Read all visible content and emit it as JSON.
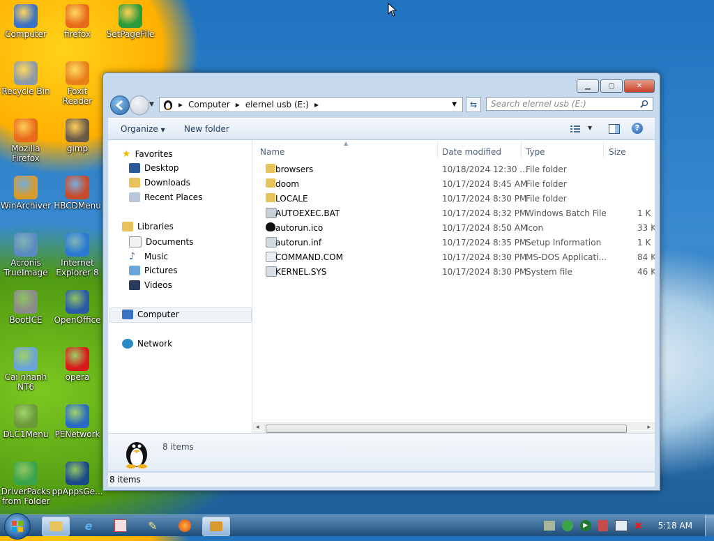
{
  "desktop": {
    "icons": [
      {
        "label": "Computer",
        "icon": "computer-icon",
        "color": "#3b73c4"
      },
      {
        "label": "firefox",
        "icon": "firefox-icon",
        "color": "#e86a1a"
      },
      {
        "label": "SetPageFile",
        "icon": "setpagefile-icon",
        "color": "#2a9a3a"
      },
      {
        "label": "Recycle Bin",
        "icon": "recycle-bin-icon",
        "color": "#8a9aa8"
      },
      {
        "label": "Foxit Reader",
        "icon": "foxit-reader-icon",
        "color": "#e8801a"
      },
      {
        "label": "Mozilla\nFirefox",
        "icon": "mozilla-firefox-icon",
        "color": "#e86a1a"
      },
      {
        "label": "gimp",
        "icon": "gimp-icon",
        "color": "#6a5a4a"
      },
      {
        "label": "WinArchiver",
        "icon": "winarchiver-icon",
        "color": "#d89a2a"
      },
      {
        "label": "HBCDMenu",
        "icon": "hbcdmenu-icon",
        "color": "#c84a2a"
      },
      {
        "label": "Acronis\nTrueImage",
        "icon": "acronis-icon",
        "color": "#5a8ac4"
      },
      {
        "label": "Internet\nExplorer 8",
        "icon": "internet-explorer-icon",
        "color": "#2a7ad4"
      },
      {
        "label": "BootICE",
        "icon": "bootice-icon",
        "color": "#8a8a8a"
      },
      {
        "label": "OpenOffice",
        "icon": "openoffice-icon",
        "color": "#2a5aa8"
      },
      {
        "label": "Cai nhanh\nNT6",
        "icon": "cai-nhanh-icon",
        "color": "#6aa4d8"
      },
      {
        "label": "opera",
        "icon": "opera-icon",
        "color": "#d81a1a"
      },
      {
        "label": "DLC1Menu",
        "icon": "dlc1menu-icon",
        "color": "#6a9a3a"
      },
      {
        "label": "PENetwork",
        "icon": "penetwork-icon",
        "color": "#2a6ac4"
      },
      {
        "label": "DriverPacks\nfrom Folder",
        "icon": "driverpacks-icon",
        "color": "#3aa44a"
      },
      {
        "label": "ppAppsGe...",
        "icon": "ppappsge-icon",
        "color": "#1a4a8a"
      }
    ]
  },
  "window": {
    "address": {
      "crumbs": [
        "Computer",
        "elernel usb (E:)"
      ]
    },
    "search": {
      "placeholder": "Search elernel usb (E:)"
    },
    "toolbar": {
      "organize": "Organize",
      "new_folder": "New folder"
    },
    "nav": {
      "favorites": "Favorites",
      "favorites_items": [
        "Desktop",
        "Downloads",
        "Recent Places"
      ],
      "libraries": "Libraries",
      "libraries_items": [
        "Documents",
        "Music",
        "Pictures",
        "Videos"
      ],
      "computer": "Computer",
      "network": "Network"
    },
    "columns": {
      "name": "Name",
      "date": "Date modified",
      "type": "Type",
      "size": "Size"
    },
    "files": [
      {
        "name": "browsers",
        "date": "10/18/2024 12:30 ...",
        "type": "File folder",
        "size": "",
        "icon": "folder-icon"
      },
      {
        "name": "doom",
        "date": "10/17/2024 8:45 AM",
        "type": "File folder",
        "size": "",
        "icon": "folder-icon"
      },
      {
        "name": "LOCALE",
        "date": "10/17/2024 8:30 PM",
        "type": "File folder",
        "size": "",
        "icon": "folder-icon"
      },
      {
        "name": "AUTOEXEC.BAT",
        "date": "10/17/2024 8:32 PM",
        "type": "Windows Batch File",
        "size": "1 K",
        "icon": "batch-file-icon"
      },
      {
        "name": "autorun.ico",
        "date": "10/17/2024 8:50 AM",
        "type": "Icon",
        "size": "33 K",
        "icon": "penguin-icon"
      },
      {
        "name": "autorun.inf",
        "date": "10/17/2024 8:35 PM",
        "type": "Setup Information",
        "size": "1 K",
        "icon": "setup-file-icon"
      },
      {
        "name": "COMMAND.COM",
        "date": "10/17/2024 8:30 PM",
        "type": "MS-DOS Applicati...",
        "size": "84 K",
        "icon": "dos-app-icon"
      },
      {
        "name": "KERNEL.SYS",
        "date": "10/17/2024 8:30 PM",
        "type": "System file",
        "size": "46 K",
        "icon": "system-file-icon"
      }
    ],
    "details": {
      "count": "8 items"
    },
    "status": {
      "count": "8 items"
    }
  },
  "taskbar": {
    "clock": "5:18 AM"
  }
}
